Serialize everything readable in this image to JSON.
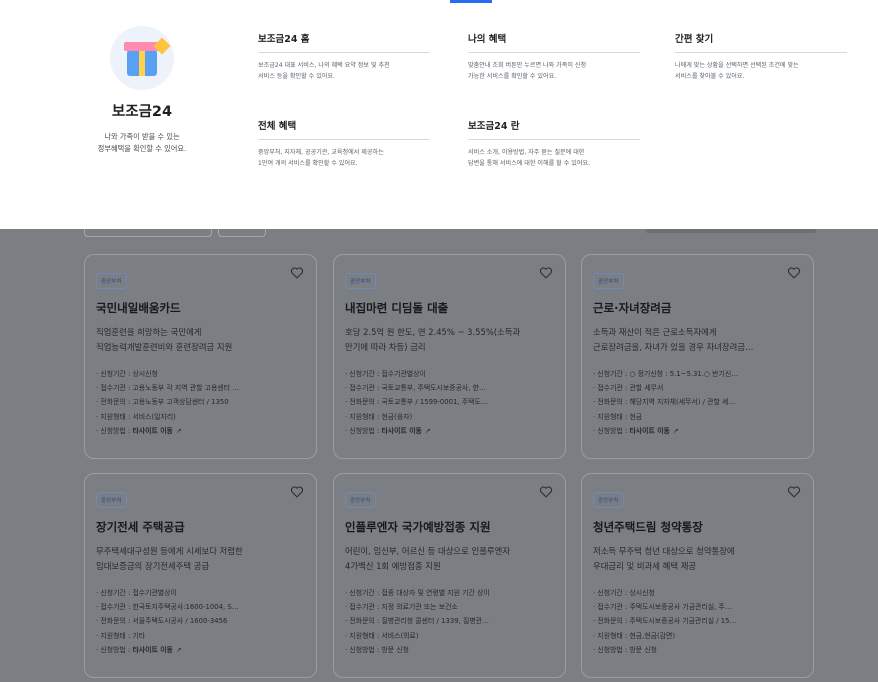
{
  "brand": {
    "name": "보조금24",
    "desc_line1": "나와 가족이 받을 수 있는",
    "desc_line2": "정부혜택을 확인할 수 있어요."
  },
  "menu": [
    {
      "title": "보조금24 홈",
      "desc_line1": "보조금24 대표 서비스, 나의 혜택 요약 정보 및 추천",
      "desc_line2": "서비스 등을 확인할 수 있어요."
    },
    {
      "title": "나의 혜택",
      "desc_line1": "맞춤안내 조회 버튼만 누르면 나와 가족이 신청",
      "desc_line2": "가능한 서비스를 확인할 수 있어요."
    },
    {
      "title": "간편 찾기",
      "desc_line1": "나에게 맞는 상황을 선택하면 선택된 조건에 맞는",
      "desc_line2": "서비스를 찾아볼 수 있어요."
    },
    {
      "title": "전체 혜택",
      "desc_line1": "중앙부처, 지자체, 공공기관, 교육청에서 제공하는",
      "desc_line2": "1만여 개의 서비스를 확인할 수 있어요."
    },
    {
      "title": "보조금24 란",
      "desc_line1": "서비스 소개, 이용방법, 자주 묻는 질문에 대한",
      "desc_line2": "답변을 통해 서비스에 대한 이해를 할 수 있어요."
    }
  ],
  "cards": [
    {
      "badge": "중앙부처",
      "title": "국민내일배움카드",
      "desc_line1": "직업훈련을 희망하는 국민에게",
      "desc_line2": "직업능력개발훈련비와 훈련장려금 지원",
      "period": "신청기간 : 상시신청",
      "agency": "접수기관 : 고용노동부 각 지역 관할 고용센터 …",
      "phone": "전화문의 : 고용노동부 고객상담센터 / 1350",
      "type": "지원형태 : 서비스(일자리)",
      "method_label": "신청방법 : ",
      "method_value": "타사이트 이동"
    },
    {
      "badge": "중앙부처",
      "title": "내집마련 디딤돌 대출",
      "desc_line1": "호당 2.5억 원 한도, 연 2.45% ~ 3.55%(소득과",
      "desc_line2": "만기에 따라 차등) 금리",
      "period": "신청기간 : 접수기관별상이",
      "agency": "접수기관 : 국토교통부, 주택도시보증공사, 한…",
      "phone": "전화문의 : 국토교통부 / 1599-0001, 주택도…",
      "type": "지원형태 : 현금(융자)",
      "method_label": "신청방법 : ",
      "method_value": "타사이트 이동"
    },
    {
      "badge": "중앙부처",
      "title": "근로·자녀장려금",
      "desc_line1": "소득과 재산이 적은 근로소득자에게",
      "desc_line2": "근로장려금을, 자녀가 있을 경우 자녀장려금…",
      "period": "신청기간 : ○ 정기신청 : 5.1~5.31.○ 반기신…",
      "agency": "접수기관 : 관할 세무서",
      "phone": "전화문의 : 해당지역 지자체(세무서) / 관할 세…",
      "type": "지원형태 : 현금",
      "method_label": "신청방법 : ",
      "method_value": "타사이트 이동"
    },
    {
      "badge": "중앙부처",
      "title": "장기전세 주택공급",
      "desc_line1": "무주택세대구성원 등에게 시세보다 저렴한",
      "desc_line2": "임대보증금의 장기전세주택 공급",
      "period": "신청기간 : 접수기관별상이",
      "agency": "접수기관 : 한국토지주택공사:1600-1004, S…",
      "phone": "전화문의 : 서울주택도시공사 / 1600-3456",
      "type": "지원형태 : 기타",
      "method_label": "신청방법 : ",
      "method_value": "타사이트 이동"
    },
    {
      "badge": "중앙부처",
      "title": "인플루엔자 국가예방접종 지원",
      "desc_line1": "어린이, 임신부, 어르신 등 대상으로 인플루엔자",
      "desc_line2": "4가백신 1회 예방접종 지원",
      "period": "신청기간 : 접종 대상자 및 연령별 지원 기간 상이",
      "agency": "접수기관 : 지정 의료기관 또는 보건소",
      "phone": "전화문의 : 질병관리청 콜센터 / 1339, 질병관…",
      "type": "지원형태 : 서비스(의료)",
      "method_label": "신청방법 : ",
      "method_value": "방문 신청"
    },
    {
      "badge": "중앙부처",
      "title": "청년주택드림 청약통장",
      "desc_line1": "저소득 무주택 청년 대상으로 청약통장에",
      "desc_line2": "우대금리 및 비과세 혜택 제공",
      "period": "신청기간 : 상시신청",
      "agency": "접수기관 : 주택도시보증공사 기금관리실, 주…",
      "phone": "전화문의 : 주택도시보증공사 기금관리실 / 15…",
      "type": "지원형태 : 현금,현금(감면)",
      "method_label": "신청방법 : ",
      "method_value": "방문 신청"
    }
  ]
}
